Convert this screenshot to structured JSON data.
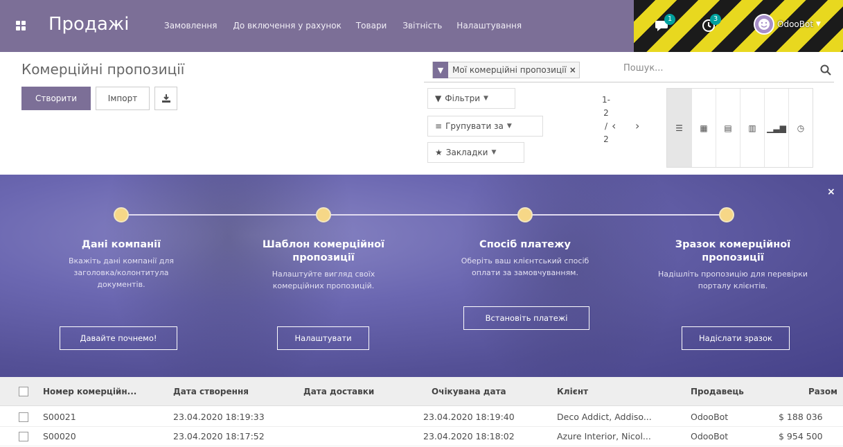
{
  "nav": {
    "brand": "Продажі",
    "menu": [
      "Замовлення",
      "До включення у рахунок",
      "Товари",
      "Звітність",
      "Налаштування"
    ],
    "chat_badge": "1",
    "activity_badge": "3",
    "user": "OdooBot"
  },
  "control": {
    "breadcrumb": "Комерційні пропозиції",
    "create": "Створити",
    "import": "Імпорт",
    "facet": "Мої комерційні пропозиції",
    "search_placeholder": "Пошук...",
    "filters": "Фільтри",
    "group_by": "Групувати за",
    "favorites": "Закладки",
    "pager": [
      "1-",
      "2",
      "/",
      "2"
    ]
  },
  "onboarding": {
    "steps": [
      {
        "title": "Дані компанії",
        "desc": "Вкажіть дані компанії для заголовка/колонтитула документів.",
        "button": "Давайте почнемо!"
      },
      {
        "title": "Шаблон комерційної пропозиції",
        "desc": "Налаштуйте вигляд своїх комерційних пропозицій.",
        "button": "Налаштувати"
      },
      {
        "title": "Спосіб платежу",
        "desc": "Оберіть ваш клієнтський спосіб оплати за замовчуванням.",
        "button": "Встановіть платежі"
      },
      {
        "title": "Зразок комерційної пропозиції",
        "desc": "Надішліть пропозицію для перевірки порталу клієнтів.",
        "button": "Надіслати зразок"
      }
    ]
  },
  "table": {
    "headers": [
      "Номер комерційн...",
      "Дата створення",
      "Дата доставки",
      "Очікувана дата",
      "Клієнт",
      "Продавець",
      "Разом"
    ],
    "rows": [
      [
        "S00021",
        "23.04.2020 18:19:33",
        "",
        "23.04.2020 18:19:40",
        "Deco Addict, Addiso...",
        "OdooBot",
        "$ 188 036"
      ],
      [
        "S00020",
        "23.04.2020 18:17:52",
        "",
        "23.04.2020 18:18:02",
        "Azure Interior, Nicol...",
        "OdooBot",
        "$ 954 500"
      ]
    ]
  },
  "colors": {
    "brand": "#7c6f97",
    "accent": "#00a09d",
    "banner": "#5c58a3"
  }
}
